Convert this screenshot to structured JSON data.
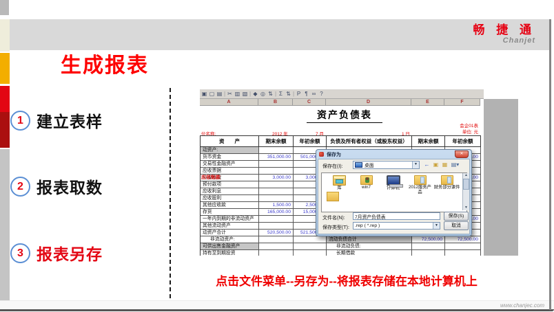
{
  "header": {
    "logo_cn": "畅 捷 通",
    "logo_en": "Chanjet"
  },
  "page_title": "生成报表",
  "steps": [
    {
      "num": "1",
      "label": "建立表样"
    },
    {
      "num": "2",
      "label": "报表取数"
    },
    {
      "num": "3",
      "label": "报表另存"
    }
  ],
  "caption": "点击文件菜单--另存为--将报表存储在本地计算机上",
  "footer": {
    "url": "www.chanjec.com"
  },
  "colors": {
    "accent_red": "#e30613",
    "title_red": "#fe0000",
    "value_blue": "#3a3acc",
    "band_gray": "#d9d9d9",
    "amber": "#f3ae00"
  },
  "spreadsheet": {
    "toolbar_icons": [
      {
        "name": "save-icon",
        "glyph": "▣"
      },
      {
        "name": "new-doc-icon",
        "glyph": "▢"
      },
      {
        "name": "print-icon",
        "glyph": "▤"
      },
      {
        "name": "separator",
        "glyph": "|"
      },
      {
        "name": "cut-icon",
        "glyph": "✂"
      },
      {
        "name": "copy-icon",
        "glyph": "▥"
      },
      {
        "name": "paste-icon",
        "glyph": "▧"
      },
      {
        "name": "separator",
        "glyph": "|"
      },
      {
        "name": "format-painter-icon",
        "glyph": "◆"
      },
      {
        "name": "find-icon",
        "glyph": "◎"
      },
      {
        "name": "filter-icon",
        "glyph": "⇅"
      },
      {
        "name": "separator",
        "glyph": "|"
      },
      {
        "name": "sum-icon",
        "glyph": "Σ"
      },
      {
        "name": "sort-icon",
        "glyph": "⇅"
      },
      {
        "name": "separator",
        "glyph": "|"
      },
      {
        "name": "paragraph-icon",
        "glyph": "P"
      },
      {
        "name": "style-icon",
        "glyph": "¶"
      },
      {
        "name": "link-icon",
        "glyph": "∞"
      },
      {
        "name": "help-icon",
        "glyph": "?"
      }
    ],
    "columns": [
      "A",
      "B",
      "C",
      "D",
      "E",
      "F"
    ],
    "report_title": "资产负债表",
    "meta": {
      "left_label": "位名称:",
      "year": "2012 年",
      "month": "7 月",
      "day": "1 日",
      "form_no": "会企01表",
      "unit": "单位: 元"
    },
    "table_headers": [
      "资　　产",
      "期末余额",
      "年初余额",
      "负债及所有者权益（或股东权益）",
      "期末余额",
      "年初余额"
    ],
    "stamp_text": "应收账款",
    "rows": [
      {
        "a": "动资产:",
        "a_bg": true
      },
      {
        "a": "货币资金",
        "b": "351,000.00",
        "c": "501,000.00",
        "f": "0.00"
      },
      {
        "a": "交易性金融资产"
      },
      {
        "a": "应收票据"
      },
      {
        "a": "应收账款",
        "b": "3,000.00",
        "c": "3,000.00",
        "f": "0.00",
        "stamp": true
      },
      {
        "a": "预付款项"
      },
      {
        "a": "应收利息"
      },
      {
        "a": "应收股利"
      },
      {
        "a": "其他应收款",
        "b": "1,500.00",
        "c": "2,500.00"
      },
      {
        "a": "存货",
        "b": "165,000.00",
        "c": "15,000.00"
      },
      {
        "a": "一年内到期的非流动资产",
        "f": "0.00"
      },
      {
        "a": "其他流动资产"
      },
      {
        "a": "动资产合计",
        "b": "520,500.00",
        "c": "521,500.00"
      },
      {
        "a": "非流动资产:",
        "a_indent": true,
        "d": "流动负债合计",
        "d_bg": true,
        "e": "72,500.00",
        "f": "72,500.00"
      },
      {
        "a": "可供出售金融资产",
        "a_bg": true,
        "d": "非流动负债:",
        "d_indent": true
      },
      {
        "a": "持有至到期投资",
        "d": "长期借款",
        "d_indent": true
      }
    ]
  },
  "dialog": {
    "title": "保存为",
    "save_in_label": "保存在(I):",
    "save_in_value": "桌面",
    "nav_icons": [
      "back-icon",
      "up-folder-icon",
      "new-folder-icon",
      "view-menu-icon"
    ],
    "items": [
      {
        "name": "库",
        "icon": "libraries-icon"
      },
      {
        "name": "win7",
        "icon": "user-folder-icon"
      },
      {
        "name": "计算机",
        "icon": "computer-icon"
      },
      {
        "name": "2012服务产品",
        "icon": "folder-icon"
      },
      {
        "name": "财务部分课件",
        "icon": "folder-icon"
      }
    ],
    "filename_label": "文件名(N):",
    "filename_value": "7月资产负债表",
    "filetype_label": "保存类型(T):",
    "filetype_value": ".rep ( *.rep )",
    "save_button": "保存(S)",
    "cancel_button": "取消"
  }
}
